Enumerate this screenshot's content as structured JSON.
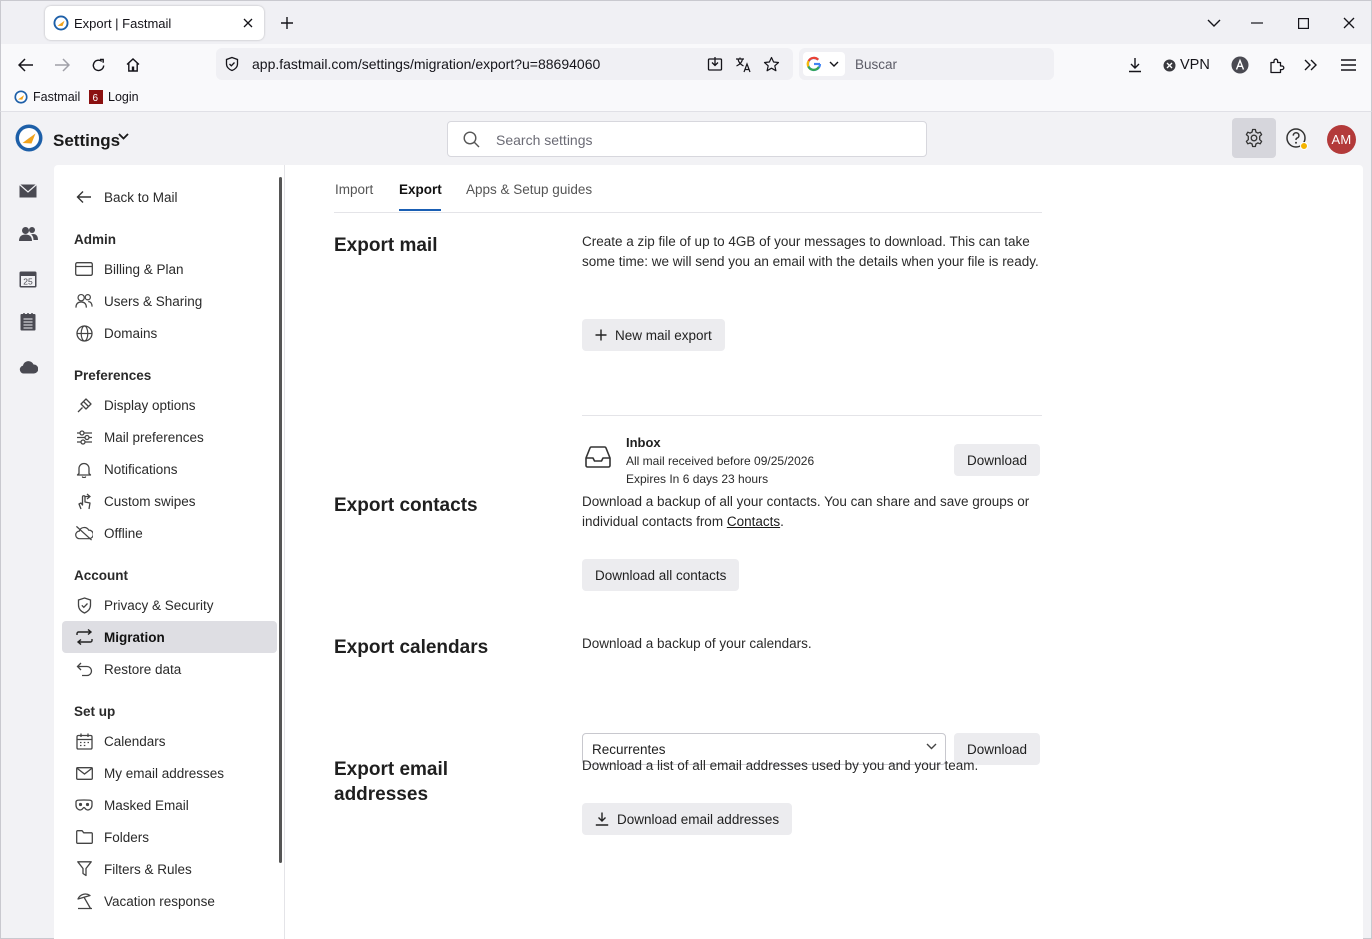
{
  "browser": {
    "tab_title": "Export | Fastmail",
    "url": "app.fastmail.com/settings/migration/export?u=88694060",
    "search_placeholder": "Buscar",
    "vpn_label": "VPN",
    "bookmarks": [
      "Fastmail",
      "Login"
    ]
  },
  "app": {
    "title": "Settings",
    "search_placeholder": "Search settings",
    "avatar_initials": "AM",
    "accent": "#1a5fb4",
    "avatar_color": "#b33a3a"
  },
  "sidebar": {
    "back": "Back to Mail",
    "sections": [
      {
        "heading": "Admin",
        "items": [
          "Billing & Plan",
          "Users & Sharing",
          "Domains"
        ]
      },
      {
        "heading": "Preferences",
        "items": [
          "Display options",
          "Mail preferences",
          "Notifications",
          "Custom swipes",
          "Offline"
        ]
      },
      {
        "heading": "Account",
        "items": [
          "Privacy & Security",
          "Migration",
          "Restore data"
        ]
      },
      {
        "heading": "Set up",
        "items": [
          "Calendars",
          "My email addresses",
          "Masked Email",
          "Folders",
          "Filters & Rules",
          "Vacation response"
        ]
      }
    ],
    "active_item": "Migration"
  },
  "tabs": [
    "Import",
    "Export",
    "Apps & Setup guides"
  ],
  "active_tab": "Export",
  "export_mail": {
    "heading": "Export mail",
    "description": "Create a zip file of up to 4GB of your messages to download. This can take some time: we will send you an email with the details when your file is ready.",
    "new_button": "New mail export",
    "item": {
      "title": "Inbox",
      "line1": "All mail received before 09/25/2026",
      "line2": "Expires In 6 days 23 hours",
      "button": "Download"
    }
  },
  "export_contacts": {
    "heading": "Export contacts",
    "description_prefix": "Download a backup of all your contacts. You can share and save groups or individual contacts from ",
    "link": "Contacts",
    "description_suffix": ".",
    "button": "Download all contacts"
  },
  "export_calendars": {
    "heading": "Export calendars",
    "description": "Download a backup of your calendars.",
    "selected": "Recurrentes",
    "button": "Download"
  },
  "export_addresses": {
    "heading_line1": "Export email",
    "heading_line2": "addresses",
    "description": "Download a list of all email addresses used by you and your team.",
    "button": "Download email addresses"
  }
}
